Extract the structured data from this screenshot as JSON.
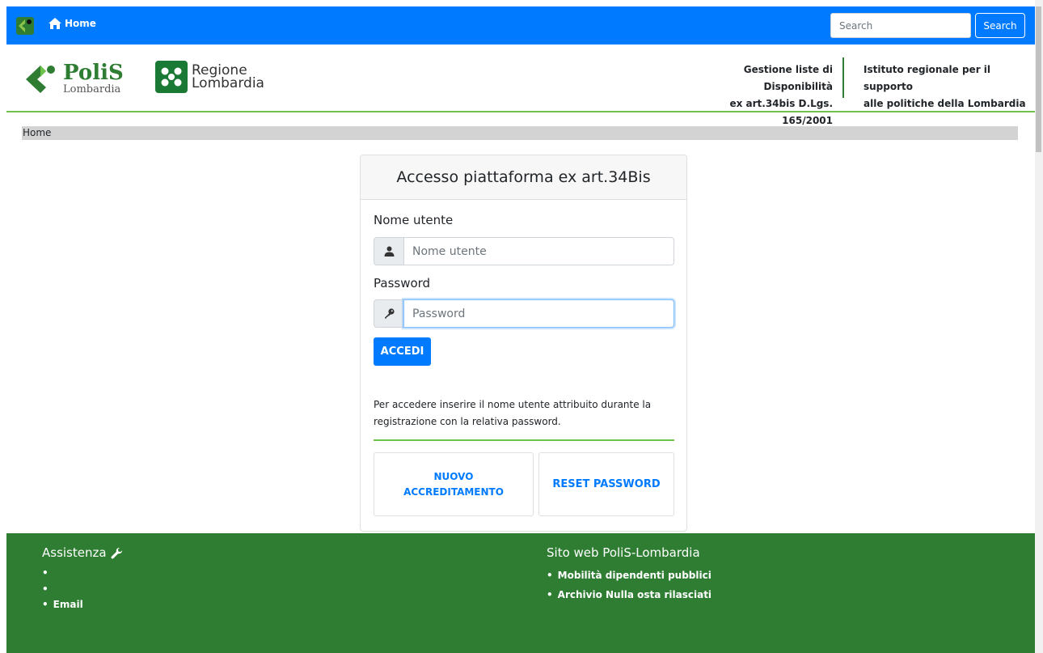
{
  "navbar": {
    "home_label": "Home",
    "search_placeholder": "Search",
    "search_button": "Search"
  },
  "header": {
    "polis_name": "PoliS",
    "polis_sub": "Lombardia",
    "regione_line1": "Regione",
    "regione_line2": "Lombardia",
    "service_line1": "Gestione liste di Disponibilità",
    "service_line2": "ex art.34bis D.Lgs. 165/2001",
    "institute_line1": "Istituto regionale per il supporto",
    "institute_line2": "alle politiche della Lombardia"
  },
  "breadcrumb": {
    "current": "Home"
  },
  "login": {
    "title": "Accesso piattaforma ex art.34Bis",
    "username_label": "Nome utente",
    "username_placeholder": "Nome utente",
    "username_value": "",
    "password_label": "Password",
    "password_placeholder": "Password",
    "password_value": "",
    "submit_label": "ACCEDI",
    "help_text": "Per accedere inserire il nome utente attribuito durante la registrazione con la relativa password.",
    "new_accreditation_line1": "NUOVO",
    "new_accreditation_line2": "ACCREDITAMENTO",
    "reset_password": "RESET PASSWORD"
  },
  "footer": {
    "assistance_title": "Assistenza",
    "assistance_items": [
      "",
      "",
      "Email"
    ],
    "website_title": "Sito web PoliS-Lombardia",
    "website_items": [
      "Mobilità dipendenti pubblici",
      "Archivio Nulla osta rilasciati"
    ]
  },
  "colors": {
    "primary": "#007bff",
    "brand_green": "#2e7d32",
    "accent_green": "#6cc24a",
    "breadcrumb_bg": "#d3d3d3"
  },
  "icons": {
    "home": "home-icon",
    "user": "user-icon",
    "key": "key-icon",
    "wrench": "wrench-icon"
  }
}
